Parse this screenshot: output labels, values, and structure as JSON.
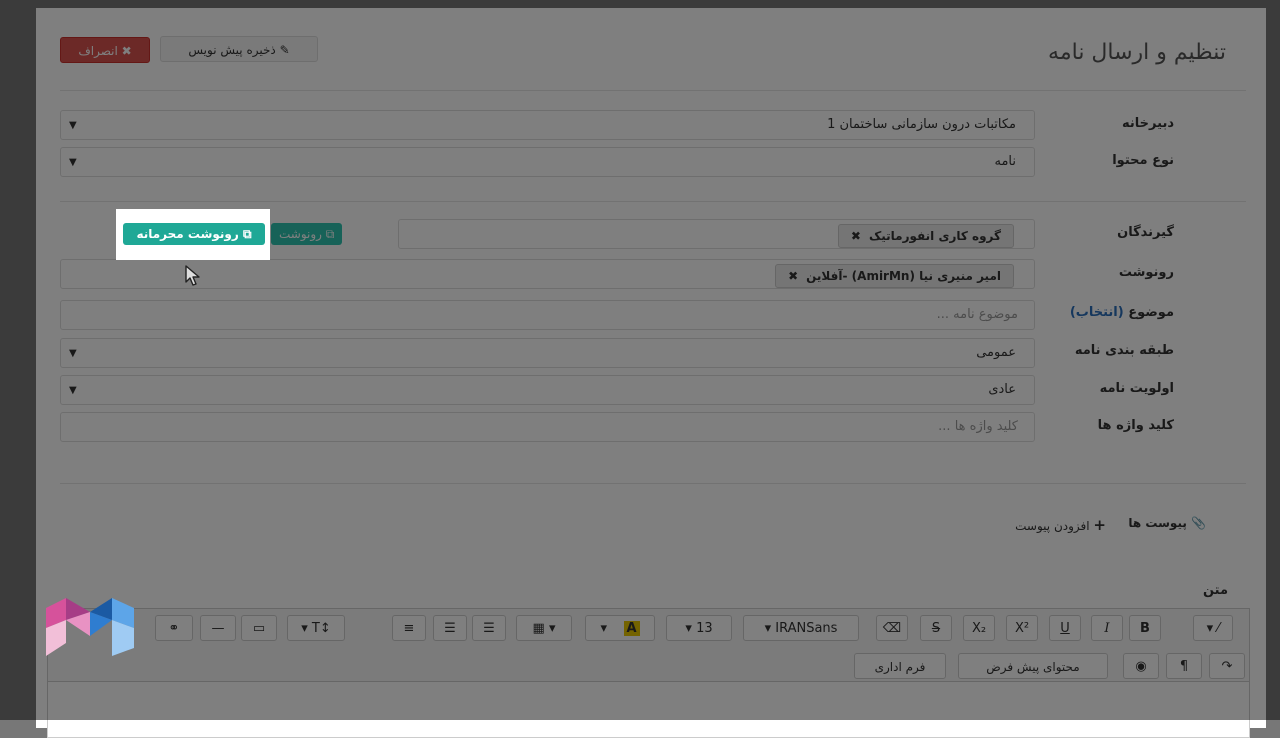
{
  "header": {
    "title": "تنظیم و ارسال نامه",
    "draft_label": "ذخیره پیش نویس",
    "cancel_label": "انصراف"
  },
  "form": {
    "secretariat": {
      "label": "دبیرخانه",
      "value": "مکاتبات درون سازمانی ساختمان 1"
    },
    "content_type": {
      "label": "نوع محتوا",
      "value": "نامه"
    },
    "recipients": {
      "label": "گیرندگان",
      "tag": "گروه کاری انفورماتیک",
      "cc_button": "رونوشت",
      "secret_cc_button": "رونوشت محرمانه"
    },
    "cc": {
      "label": "رونوشت",
      "tag": "امیر منیری نیا (AmirMn) -آفلاین"
    },
    "subject": {
      "label": "موضوع",
      "select_link": "(انتخاب)",
      "placeholder": "موضوع نامه ..."
    },
    "category": {
      "label": "طبقه بندی نامه",
      "value": "عمومی"
    },
    "priority": {
      "label": "اولویت نامه",
      "value": "عادی"
    },
    "keywords": {
      "label": "کلید واژه ها",
      "placeholder": "کلید واژه ها ..."
    }
  },
  "attachments": {
    "label": "پیوست ها",
    "add_label": "افزودن پیوست"
  },
  "editor": {
    "label": "متن",
    "font_family": "IRANSans",
    "font_size": "13",
    "buttons": {
      "bold": "B",
      "italic": "I",
      "underline": "U",
      "superscript": "X²",
      "subscript": "X₂",
      "strike": "S",
      "font_color": "A",
      "text_size": "T↕",
      "default_content": "محتوای پیش فرض",
      "admin_form": "فرم اداری"
    }
  },
  "icons": {
    "caret": "caret-down-icon",
    "close": "close-icon",
    "pencil": "pencil-icon",
    "plus": "plus-icon",
    "paperclip": "paperclip-icon",
    "copy": "copy-icon",
    "cursor": "mouse-cursor-icon"
  },
  "colors": {
    "cancel": "#d9534f",
    "cc_button": "#2ec4b0",
    "secret_cc": "#1fa896",
    "link": "#2a6ebb"
  }
}
